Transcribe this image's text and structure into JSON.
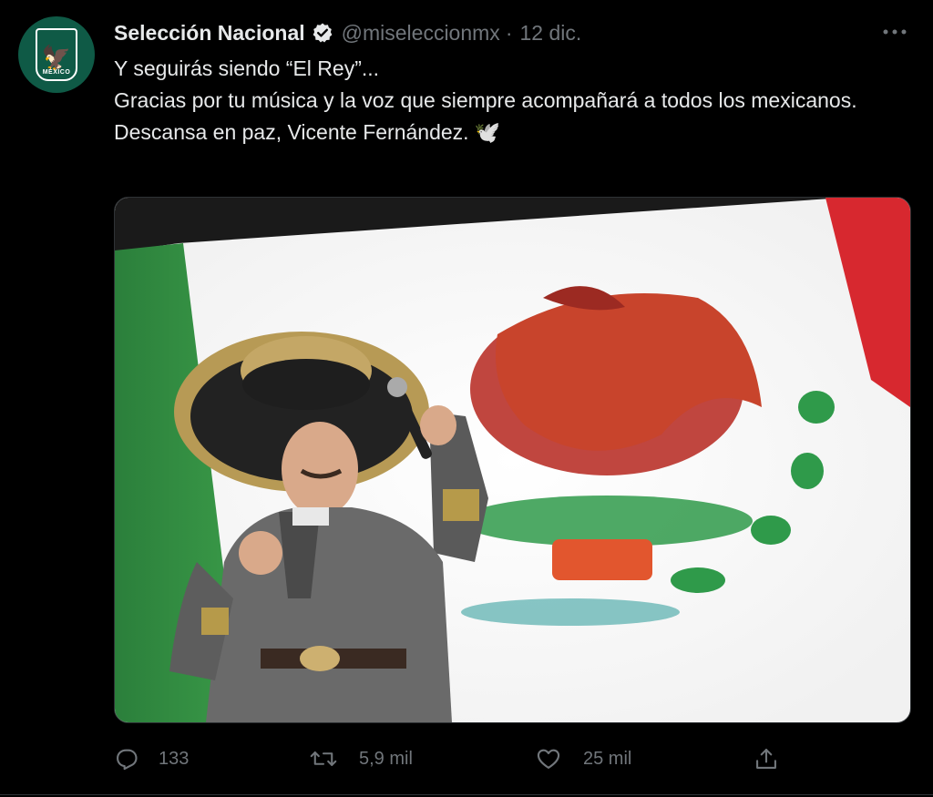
{
  "account": {
    "name": "Selección Nacional",
    "handle": "@miseleccionmx",
    "separator": "·",
    "date": "12 dic.",
    "avatar_text": "MÉXICO",
    "verified": true
  },
  "tweet": {
    "lines": [
      "Y seguirás siendo “El Rey”...",
      "Gracias por tu música y la voz que siempre acompañará a todos los mexicanos.",
      "Descansa en paz, Vicente Fernández. 🕊️"
    ]
  },
  "actions": {
    "reply_count": "133",
    "retweet_count": "5,9 mil",
    "like_count": "25 mil"
  },
  "icons": {
    "more": "more-icon",
    "reply": "reply-icon",
    "retweet": "retweet-icon",
    "like": "like-icon",
    "share": "share-icon",
    "verified": "verified-icon"
  },
  "colors": {
    "background": "#000000",
    "text_primary": "#e7e9ea",
    "text_secondary": "#71767b",
    "avatar_green": "#0f5a46",
    "flag_green": "#2f8a3f",
    "flag_red": "#d7282f"
  }
}
